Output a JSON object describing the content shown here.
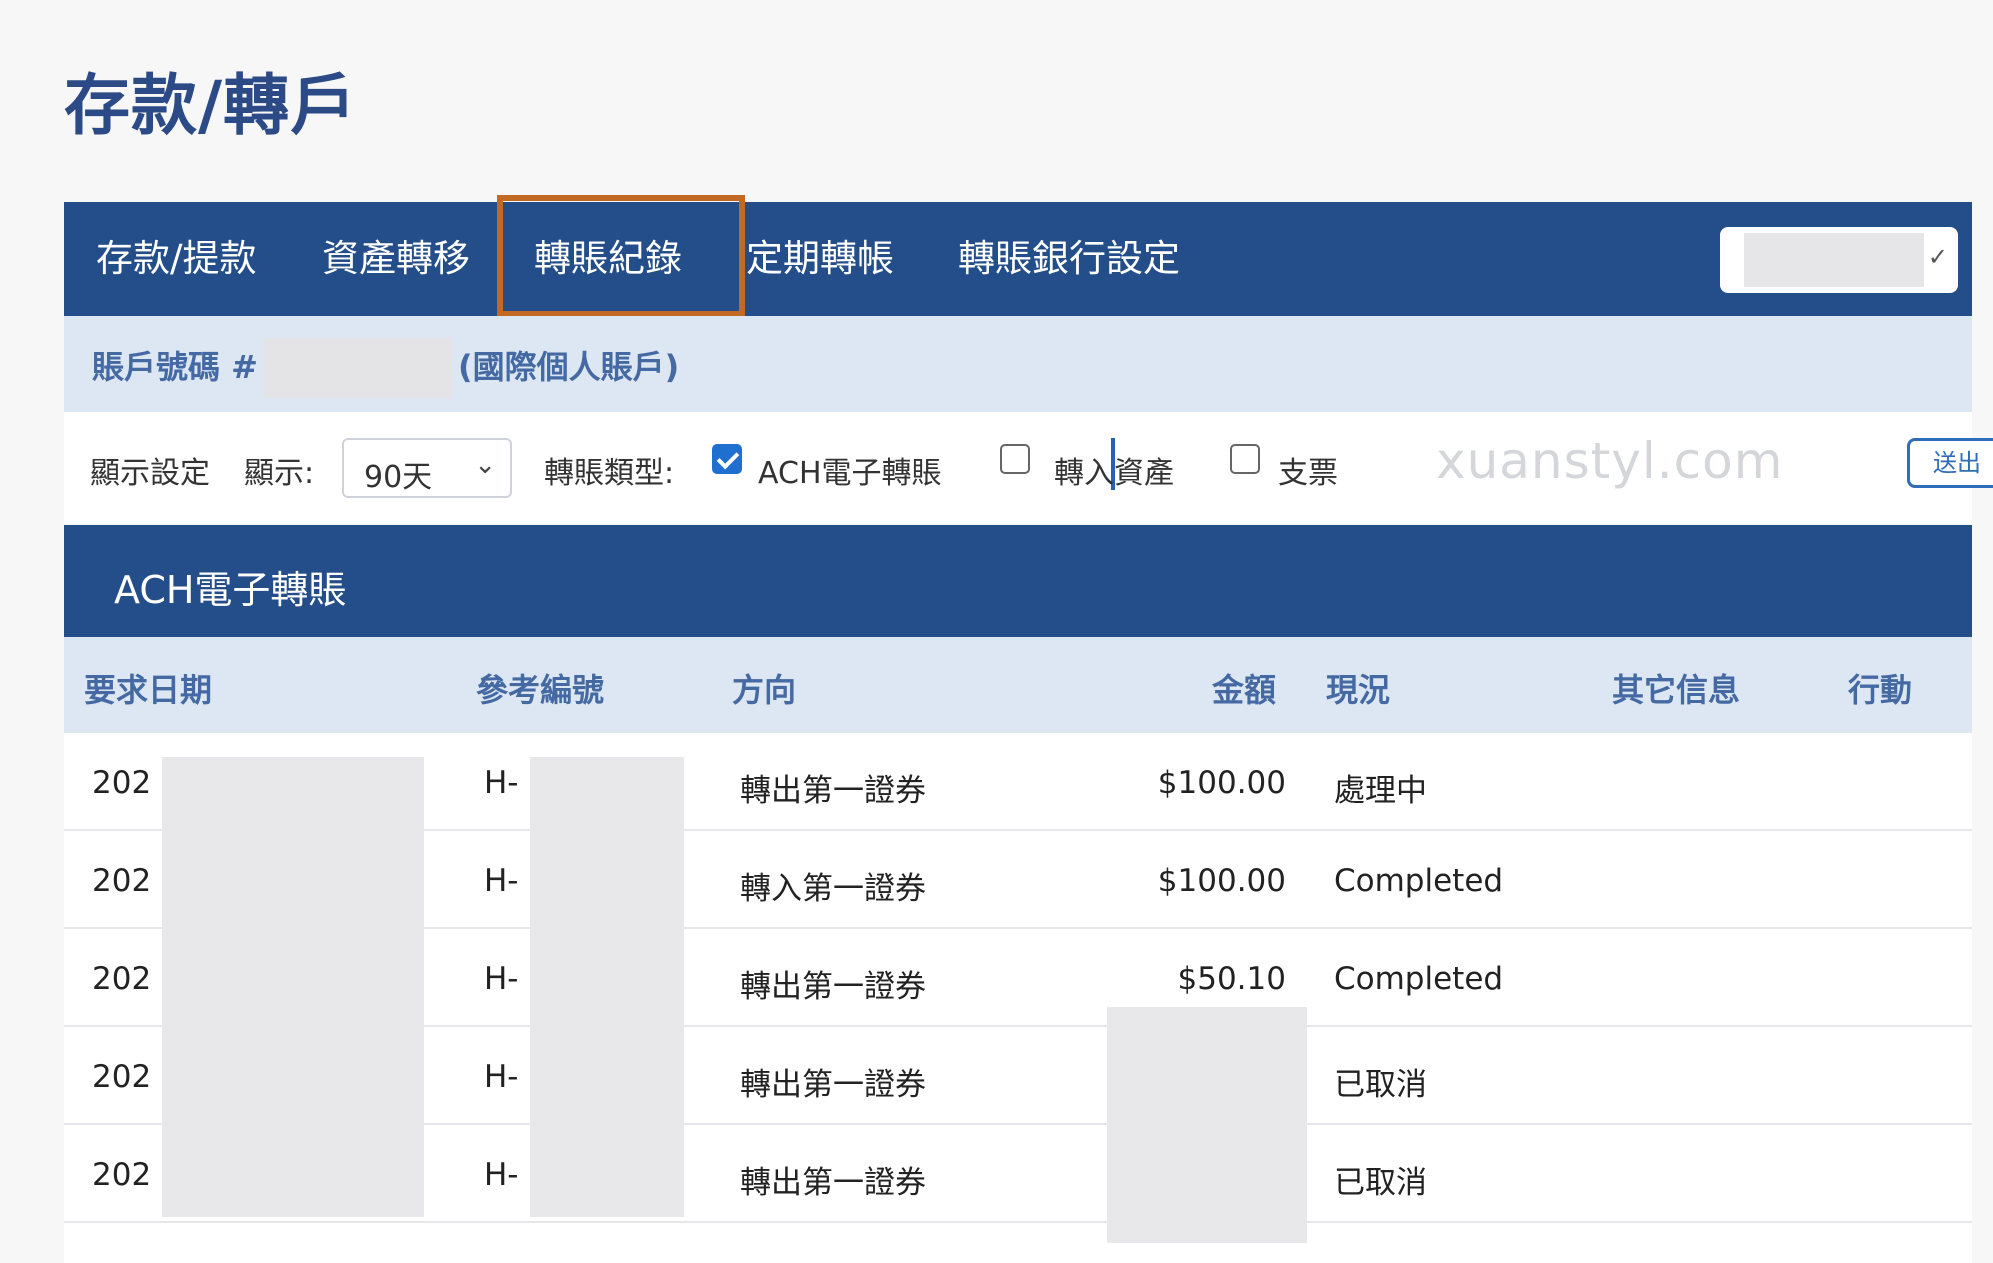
{
  "page": {
    "title": "存款/轉戶"
  },
  "tabs": [
    {
      "label": "存款/提款"
    },
    {
      "label": "資產轉移"
    },
    {
      "label": "轉賬紀錄"
    },
    {
      "label": "定期轉帳"
    },
    {
      "label": "轉賬銀行設定"
    }
  ],
  "active_tab": "轉賬紀錄",
  "account": {
    "label": "賬戶號碼 #",
    "type": "(國際個人賬戶)"
  },
  "settings": {
    "display_settings_label": "顯示設定",
    "show_label": "顯示:",
    "range_value": "90天",
    "type_label": "轉賬類型:",
    "ach_label": "ACH電子轉賬",
    "ach_checked": true,
    "asset_in_label": "轉入資產",
    "asset_in_checked": false,
    "check_label": "支票",
    "check_checked": false,
    "watermark": "xuanstyl.com",
    "submit_label": "送出"
  },
  "section": {
    "title": "ACH電子轉賬"
  },
  "table": {
    "headers": {
      "date": "要求日期",
      "ref": "參考編號",
      "direction": "方向",
      "amount": "金額",
      "status": "現況",
      "info": "其它信息",
      "action": "行動"
    },
    "rows": [
      {
        "date": "202",
        "ref": "H-",
        "direction": "轉出第一證券",
        "amount": "$100.00",
        "status": "處理中"
      },
      {
        "date": "202",
        "ref": "H-",
        "direction": "轉入第一證券",
        "amount": "$100.00",
        "status": "Completed"
      },
      {
        "date": "202",
        "ref": "H-",
        "direction": "轉出第一證券",
        "amount": "$50.10",
        "status": "Completed"
      },
      {
        "date": "202",
        "ref": "H-",
        "direction": "轉出第一證券",
        "amount": "",
        "status": "已取消"
      },
      {
        "date": "202",
        "ref": "H-",
        "direction": "轉出第一證券",
        "amount": "",
        "status": "已取消"
      }
    ]
  }
}
